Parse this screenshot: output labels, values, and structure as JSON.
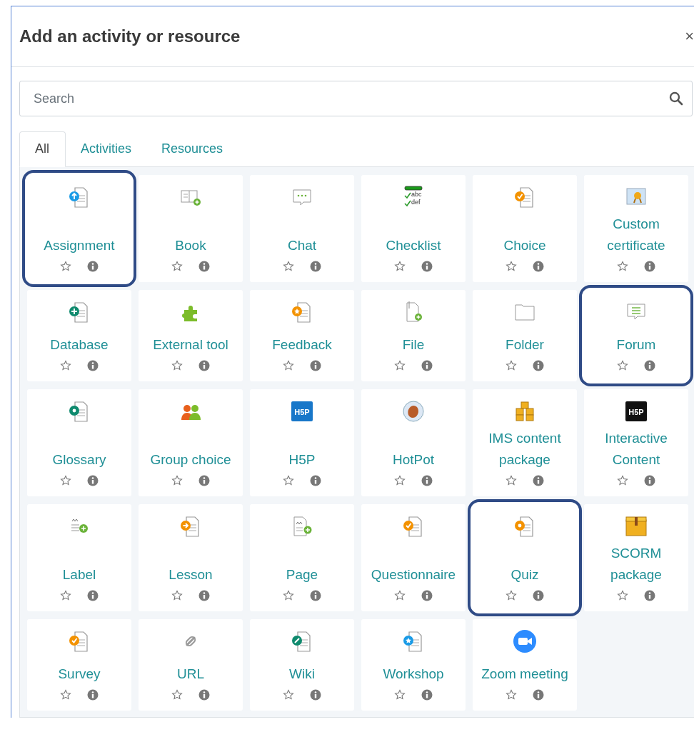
{
  "dialog": {
    "title": "Add an activity or resource",
    "close": "×"
  },
  "search": {
    "placeholder": "Search"
  },
  "tabs": [
    {
      "label": "All",
      "selected": true
    },
    {
      "label": "Activities",
      "selected": false
    },
    {
      "label": "Resources",
      "selected": false
    }
  ],
  "items": [
    {
      "name": "Assignment",
      "highlighted": true
    },
    {
      "name": "Book",
      "highlighted": false
    },
    {
      "name": "Chat",
      "highlighted": false
    },
    {
      "name": "Checklist",
      "highlighted": false,
      "icon_text": [
        "abc",
        "def"
      ]
    },
    {
      "name": "Choice",
      "highlighted": false
    },
    {
      "name": "Custom certificate",
      "highlighted": false
    },
    {
      "name": "Database",
      "highlighted": false
    },
    {
      "name": "External tool",
      "highlighted": false
    },
    {
      "name": "Feedback",
      "highlighted": false
    },
    {
      "name": "File",
      "highlighted": false
    },
    {
      "name": "Folder",
      "highlighted": false
    },
    {
      "name": "Forum",
      "highlighted": true
    },
    {
      "name": "Glossary",
      "highlighted": false
    },
    {
      "name": "Group choice",
      "highlighted": false
    },
    {
      "name": "H5P",
      "highlighted": false,
      "icon_text": [
        "H5P"
      ]
    },
    {
      "name": "HotPot",
      "highlighted": false
    },
    {
      "name": "IMS content package",
      "highlighted": false
    },
    {
      "name": "Interactive Content",
      "highlighted": false,
      "icon_text": [
        "H5P"
      ]
    },
    {
      "name": "Label",
      "highlighted": false
    },
    {
      "name": "Lesson",
      "highlighted": false
    },
    {
      "name": "Page",
      "highlighted": false
    },
    {
      "name": "Questionnaire",
      "highlighted": false
    },
    {
      "name": "Quiz",
      "highlighted": true
    },
    {
      "name": "SCORM package",
      "highlighted": false
    },
    {
      "name": "Survey",
      "highlighted": false
    },
    {
      "name": "URL",
      "highlighted": false
    },
    {
      "name": "Wiki",
      "highlighted": false
    },
    {
      "name": "Workshop",
      "highlighted": false
    },
    {
      "name": "Zoom meeting",
      "highlighted": false
    }
  ]
}
